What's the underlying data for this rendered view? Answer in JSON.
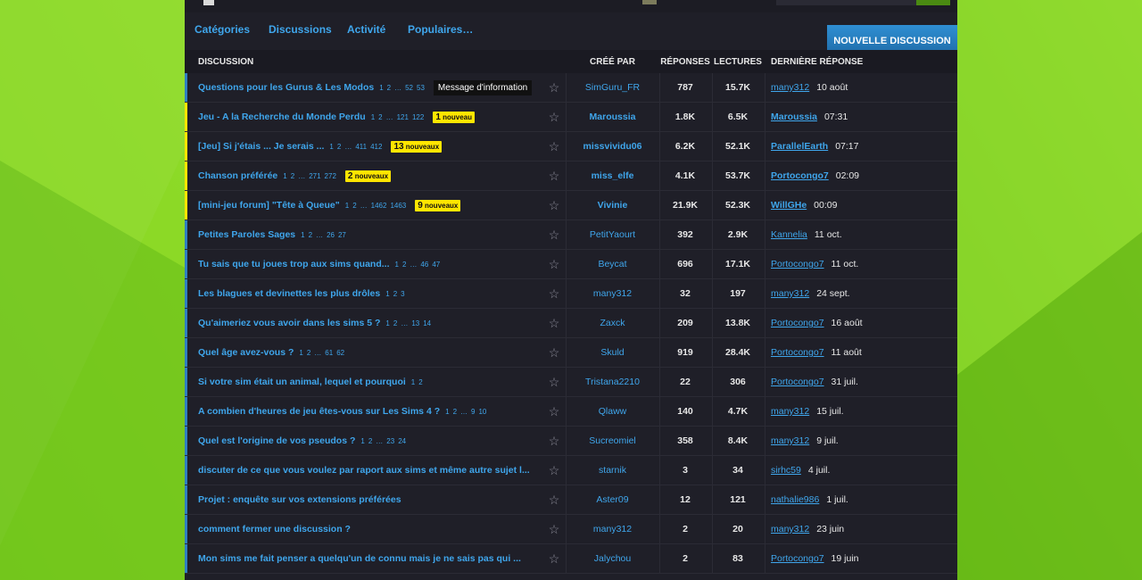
{
  "nav": {
    "links": [
      "Catégories",
      "Discussions",
      "Activité",
      "Populaires…"
    ],
    "new_discussion": "NOUVELLE DISCUSSION"
  },
  "table": {
    "headers": {
      "discussion": "DISCUSSION",
      "created_by": "CRÉÉ PAR",
      "replies": "RÉPONSES",
      "views": "LECTURES",
      "last_reply": "DERNIÈRE RÉPONSE"
    },
    "rows": [
      {
        "title": "Questions pour les Gurus & Les Modos",
        "pages": [
          "1",
          "2",
          "…",
          "52",
          "53"
        ],
        "tag": "Message d'information",
        "new_count": "",
        "new_label": "",
        "author": "SimGuru_FR",
        "replies": "787",
        "views": "15.7K",
        "last_user": "many312",
        "last_date": "10 août",
        "unread": false
      },
      {
        "title": "Jeu - A la Recherche du Monde Perdu",
        "pages": [
          "1",
          "2",
          "…",
          "121",
          "122"
        ],
        "tag": "",
        "new_count": "1",
        "new_label": "nouveau",
        "author": "Maroussia",
        "replies": "1.8K",
        "views": "6.5K",
        "last_user": "Maroussia",
        "last_date": "07:31",
        "unread": true
      },
      {
        "title": "[Jeu] Si j'étais ... Je serais ...",
        "pages": [
          "1",
          "2",
          "…",
          "411",
          "412"
        ],
        "tag": "",
        "new_count": "13",
        "new_label": "nouveaux",
        "author": "missvividu06",
        "replies": "6.2K",
        "views": "52.1K",
        "last_user": "ParallelEarth",
        "last_date": "07:17",
        "unread": true
      },
      {
        "title": "Chanson préférée",
        "pages": [
          "1",
          "2",
          "…",
          "271",
          "272"
        ],
        "tag": "",
        "new_count": "2",
        "new_label": "nouveaux",
        "author": "miss_elfe",
        "replies": "4.1K",
        "views": "53.7K",
        "last_user": "Portocongo7",
        "last_date": "02:09",
        "unread": true
      },
      {
        "title": "[mini-jeu forum] \"Tête à Queue\"",
        "pages": [
          "1",
          "2",
          "…",
          "1462",
          "1463"
        ],
        "tag": "",
        "new_count": "9",
        "new_label": "nouveaux",
        "author": "Vivinie",
        "replies": "21.9K",
        "views": "52.3K",
        "last_user": "WillGHe",
        "last_date": "00:09",
        "unread": true
      },
      {
        "title": "Petites Paroles Sages",
        "pages": [
          "1",
          "2",
          "…",
          "26",
          "27"
        ],
        "tag": "",
        "new_count": "",
        "new_label": "",
        "author": "PetitYaourt",
        "replies": "392",
        "views": "2.9K",
        "last_user": "Kannelia",
        "last_date": "11 oct.",
        "unread": false
      },
      {
        "title": "Tu sais que tu joues trop aux sims quand...",
        "pages": [
          "1",
          "2",
          "…",
          "46",
          "47"
        ],
        "tag": "",
        "new_count": "",
        "new_label": "",
        "author": "Beycat",
        "replies": "696",
        "views": "17.1K",
        "last_user": "Portocongo7",
        "last_date": "11 oct.",
        "unread": false
      },
      {
        "title": "Les blagues et devinettes les plus drôles",
        "pages": [
          "1",
          "2",
          "3"
        ],
        "tag": "",
        "new_count": "",
        "new_label": "",
        "author": "many312",
        "replies": "32",
        "views": "197",
        "last_user": "many312",
        "last_date": "24 sept.",
        "unread": false
      },
      {
        "title": "Qu'aimeriez vous avoir dans les sims 5 ?",
        "pages": [
          "1",
          "2",
          "…",
          "13",
          "14"
        ],
        "tag": "",
        "new_count": "",
        "new_label": "",
        "author": "Zaxck",
        "replies": "209",
        "views": "13.8K",
        "last_user": "Portocongo7",
        "last_date": "16 août",
        "unread": false
      },
      {
        "title": "Quel âge avez-vous ?",
        "pages": [
          "1",
          "2",
          "…",
          "61",
          "62"
        ],
        "tag": "",
        "new_count": "",
        "new_label": "",
        "author": "Skuld",
        "replies": "919",
        "views": "28.4K",
        "last_user": "Portocongo7",
        "last_date": "11 août",
        "unread": false
      },
      {
        "title": "Si votre sim était un animal, lequel et pourquoi",
        "pages": [
          "1",
          "2"
        ],
        "tag": "",
        "new_count": "",
        "new_label": "",
        "author": "Tristana2210",
        "replies": "22",
        "views": "306",
        "last_user": "Portocongo7",
        "last_date": "31 juil.",
        "unread": false
      },
      {
        "title": "A combien d'heures de jeu êtes-vous sur Les Sims 4 ?",
        "pages": [
          "1",
          "2",
          "…",
          "9",
          "10"
        ],
        "tag": "",
        "new_count": "",
        "new_label": "",
        "author": "Qlaww",
        "replies": "140",
        "views": "4.7K",
        "last_user": "many312",
        "last_date": "15 juil.",
        "unread": false
      },
      {
        "title": "Quel est l'origine de vos pseudos ?",
        "pages": [
          "1",
          "2",
          "…",
          "23",
          "24"
        ],
        "tag": "",
        "new_count": "",
        "new_label": "",
        "author": "Sucreomiel",
        "replies": "358",
        "views": "8.4K",
        "last_user": "many312",
        "last_date": "9 juil.",
        "unread": false
      },
      {
        "title": "discuter de ce que vous voulez par raport aux sims et même autre sujet l...",
        "pages": [],
        "tag": "",
        "new_count": "",
        "new_label": "",
        "author": "starnik",
        "replies": "3",
        "views": "34",
        "last_user": "sirhc59",
        "last_date": "4 juil.",
        "unread": false
      },
      {
        "title": "Projet : enquête sur vos extensions préférées",
        "pages": [],
        "tag": "",
        "new_count": "",
        "new_label": "",
        "author": "Aster09",
        "replies": "12",
        "views": "121",
        "last_user": "nathalie986",
        "last_date": "1 juil.",
        "unread": false
      },
      {
        "title": "comment fermer une discussion ?",
        "pages": [],
        "tag": "",
        "new_count": "",
        "new_label": "",
        "author": "many312",
        "replies": "2",
        "views": "20",
        "last_user": "many312",
        "last_date": "23 juin",
        "unread": false
      },
      {
        "title": "Mon sims me fait penser a quelqu'un de connu mais je ne sais pas qui ...",
        "pages": [],
        "tag": "",
        "new_count": "",
        "new_label": "",
        "author": "Jalychou",
        "replies": "2",
        "views": "83",
        "last_user": "Portocongo7",
        "last_date": "19 juin",
        "unread": false
      }
    ]
  },
  "icons": {
    "star": "star-outline-icon"
  },
  "colors": {
    "link": "#3fa6ec",
    "new_badge": "#ffe600",
    "button": "#2f8fd3",
    "background_green": "#7fd11f"
  }
}
